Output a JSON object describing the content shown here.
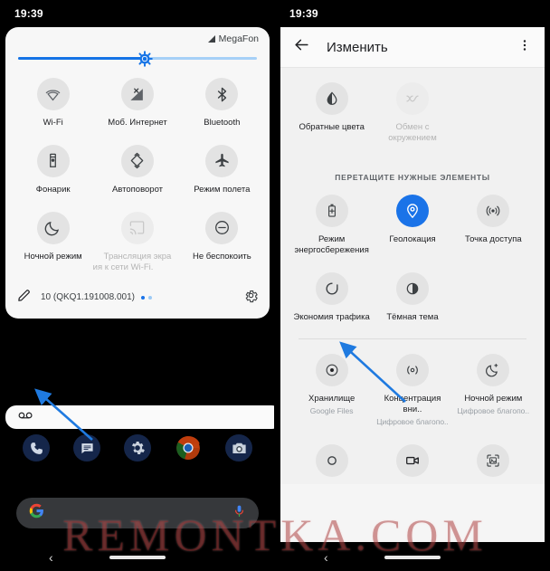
{
  "watermark": "REMONTKA.COM",
  "colors": {
    "accent_blue": "#1a73e8",
    "slider_fill": "#1573e6",
    "slider_track": "#a6d0f7",
    "tile_bg": "#e3e3e3",
    "panel_bg": "#f5f5f5",
    "text_primary": "#202124",
    "text_muted": "#9aa0a6",
    "arrow_blue": "#1f7ae0"
  },
  "left": {
    "status": {
      "clock": "19:39"
    },
    "carrier": {
      "name": "MegaFon",
      "signal_icon": "signal-triangle-icon"
    },
    "brightness": {
      "icon": "brightness-icon",
      "value_percent": 53
    },
    "tiles": [
      {
        "label": "Wi-Fi",
        "icon": "wifi-icon",
        "state": "inactive"
      },
      {
        "label": "Моб. Интернет",
        "icon": "cell-signal-off-icon",
        "state": "inactive"
      },
      {
        "label": "Bluetooth",
        "icon": "bluetooth-icon",
        "state": "inactive"
      },
      {
        "label": "Фонарик",
        "icon": "flashlight-icon",
        "state": "inactive"
      },
      {
        "label": "Автоповорот",
        "icon": "auto-rotate-icon",
        "state": "inactive"
      },
      {
        "label": "Режим полета",
        "icon": "airplane-icon",
        "state": "inactive"
      },
      {
        "label": "Ночной режим",
        "icon": "moon-icon",
        "state": "inactive"
      },
      {
        "label": "Трансляция экра",
        "label2": "ия к сети Wi-Fi.",
        "icon": "cast-icon",
        "state": "disabled"
      },
      {
        "label": "Не беспокоить",
        "icon": "do-not-disturb-icon",
        "state": "inactive"
      }
    ],
    "footer": {
      "edit_icon": "pencil-icon",
      "version": "10 (QKQ1.191008.001)",
      "page_dots": 2,
      "active_dot": 1,
      "settings_icon": "gear-icon"
    },
    "notification": {
      "icon": "voicemail-icon"
    },
    "dock": [
      {
        "name": "phone-app",
        "icon": "phone-icon"
      },
      {
        "name": "messages-app",
        "icon": "messages-icon"
      },
      {
        "name": "settings-app",
        "icon": "gear-icon"
      },
      {
        "name": "chrome-app",
        "icon": "chrome-icon"
      },
      {
        "name": "camera-app",
        "icon": "camera-icon"
      }
    ],
    "search": {
      "left_icon": "google-g-icon",
      "right_icon": "microphone-icon"
    },
    "navbar": {
      "back_icon": "back-chevron-icon",
      "pill": "home-pill"
    }
  },
  "right": {
    "status": {
      "clock": "19:39"
    },
    "appbar": {
      "back_icon": "back-arrow-icon",
      "title": "Изменить",
      "overflow_icon": "overflow-menu-icon"
    },
    "top_tiles": [
      {
        "label": "Обратные цвета",
        "icon": "invert-colors-icon",
        "state": "inactive"
      },
      {
        "label": "Обмен с окружением",
        "icon": "nearby-share-icon",
        "state": "disabled"
      }
    ],
    "section_header": "ПЕРЕТАЩИТЕ НУЖНЫЕ ЭЛЕМЕНТЫ",
    "drag_tiles": [
      {
        "label": "Режим энергосбережения",
        "icon": "battery-saver-icon",
        "state": "inactive"
      },
      {
        "label": "Геолокация",
        "icon": "location-pin-icon",
        "state": "active"
      },
      {
        "label": "Точка доступа",
        "icon": "hotspot-icon",
        "state": "inactive"
      },
      {
        "label": "Экономия трафика",
        "icon": "data-saver-icon",
        "state": "inactive"
      },
      {
        "label": "Тёмная тема",
        "icon": "dark-theme-icon",
        "state": "inactive"
      }
    ],
    "extra_tiles": [
      {
        "label": "Хранилище",
        "sub": "Google Files",
        "icon": "storage-icon",
        "state": "inactive"
      },
      {
        "label": "Концентрация вни..",
        "sub": "Цифровое благопо..",
        "icon": "focus-mode-icon",
        "state": "inactive"
      },
      {
        "label": "Ночной режим",
        "sub": "Цифровое благопо..",
        "icon": "bedtime-icon",
        "state": "inactive"
      }
    ],
    "partial_tiles": [
      {
        "icon": "record-circle-icon"
      },
      {
        "icon": "screen-record-icon"
      },
      {
        "icon": "screenshot-icon"
      }
    ],
    "navbar": {
      "back_icon": "back-chevron-icon",
      "pill": "home-pill"
    }
  }
}
